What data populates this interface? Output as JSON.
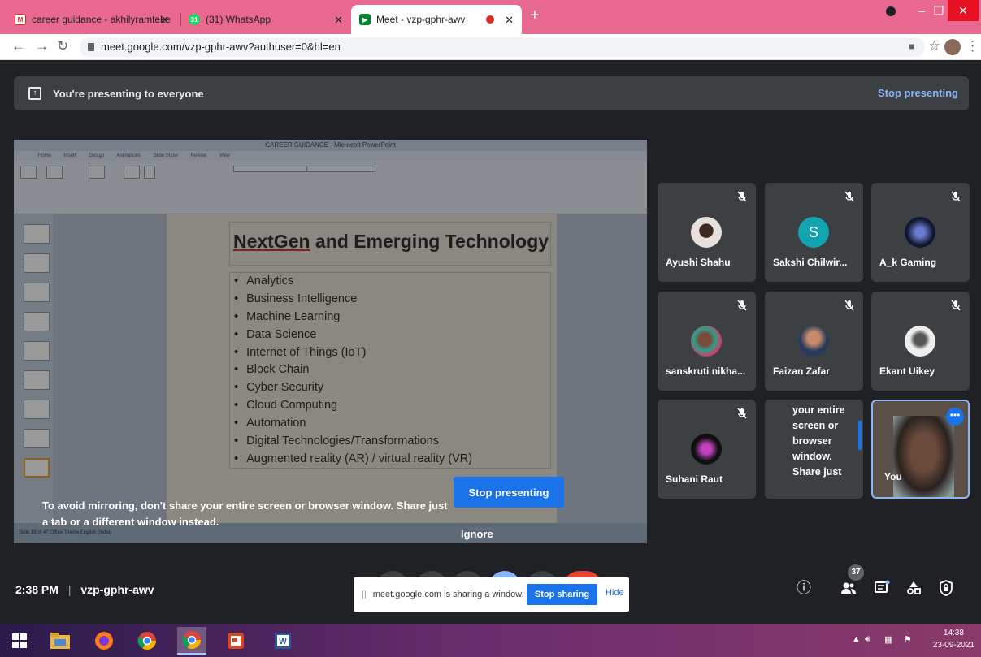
{
  "browser": {
    "tabs": [
      {
        "title": "career guidance - akhilyramteke",
        "favicon": "gmail-icon"
      },
      {
        "title": "(31) WhatsApp",
        "favicon": "whatsapp-icon"
      },
      {
        "title": "Meet - vzp-gphr-awv",
        "favicon": "meet-icon",
        "active": true
      }
    ],
    "new_tab": "+",
    "url": "meet.google.com/vzp-gphr-awv?authuser=0&hl=en"
  },
  "meet": {
    "banner_text": "You're presenting to everyone",
    "banner_stop": "Stop presenting",
    "shared_screen": {
      "window_title": "CAREER GUIDANCE - Microsoft PowerPoint",
      "ribbon_tabs": [
        "Home",
        "Insert",
        "Design",
        "Animations",
        "Slide Show",
        "Review",
        "View"
      ],
      "slide_title_a": "NextGen",
      "slide_title_b": " and Emerging Technology",
      "bullets": [
        "Analytics",
        "Business Intelligence",
        "Machine Learning",
        "Data Science",
        "Internet of Things (IoT)",
        "Block Chain",
        "Cyber Security",
        "Cloud Computing",
        "Automation",
        "Digital Technologies/Transformations",
        "Augmented reality (AR) / virtual reality (VR)"
      ],
      "status_text": "Slide 16 of 47    Office Theme    English (India)"
    },
    "mirror_warning": "To avoid mirroring, don't share your entire screen or browser window. Share just a tab or a different window instead.",
    "stop_button": "Stop presenting",
    "ignore": "Ignore",
    "participants": [
      {
        "name": "Ayushi Shahu",
        "avatar": "photo",
        "muted": true
      },
      {
        "name": "Sakshi Chilwir...",
        "avatar": "letter",
        "letter": "S",
        "muted": true
      },
      {
        "name": "A_k Gaming",
        "avatar": "photo",
        "muted": true
      },
      {
        "name": "sanskruti nikha...",
        "avatar": "photo",
        "muted": true
      },
      {
        "name": "Faizan Zafar",
        "avatar": "photo",
        "muted": true
      },
      {
        "name": "Ekant Uikey",
        "avatar": "photo",
        "muted": true
      },
      {
        "name": "Suhani Raut",
        "avatar": "photo",
        "muted": true
      }
    ],
    "presentation_tile_text": "your entire screen or browser window. Share just",
    "self_label": "You",
    "time": "2:38 PM",
    "meeting_code": "vzp-gphr-awv",
    "share_notice": "meet.google.com is sharing a window.",
    "stop_sharing": "Stop sharing",
    "hide": "Hide",
    "people_count": "37"
  },
  "taskbar": {
    "time": "14:38",
    "date": "23-09-2021"
  },
  "colors": {
    "tab_strip": "#e8688f",
    "meet_bg": "#202124",
    "accent_blue": "#1a73e8",
    "link_blue": "#8ab4f8"
  }
}
